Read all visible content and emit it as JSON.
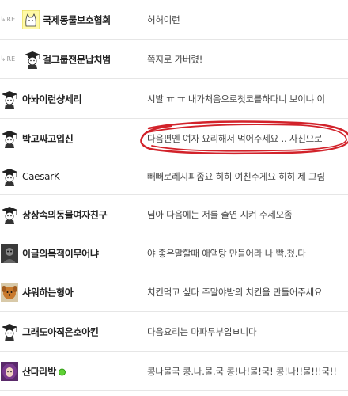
{
  "colors": {
    "highlight": "#d2222a",
    "online": "#5fd135"
  },
  "rows": [
    {
      "reply": true,
      "avatar_icon": "cat-avatar-icon",
      "nickname": "국제동물보호협회",
      "comment": "허허이런"
    },
    {
      "reply": true,
      "avatar_icon": "graduate-icon",
      "nickname": "걸그룹전문납치범",
      "comment": "쪽지로 가버렸!"
    },
    {
      "reply": false,
      "avatar_icon": "graduate-icon",
      "nickname": "아놔이런샹세리",
      "comment": "시발 ㅠ ㅠ 내가처음으로첫코를하다니 보이냐 이"
    },
    {
      "reply": false,
      "avatar_icon": "graduate-icon",
      "nickname": "박고싸고입신",
      "comment": "다음편엔 여자 요리해서 먹어주세요 .. 사진으로"
    },
    {
      "reply": false,
      "avatar_icon": "graduate-icon",
      "nickname": "CaesarK",
      "comment": "빼빼로레시피좀요 히히 여친주게요 히히 제 그림"
    },
    {
      "reply": false,
      "avatar_icon": "graduate-icon",
      "nickname": "상상속의동물여자친구",
      "comment": "님아 다음에는 저를 출연 시켜 주세오좀"
    },
    {
      "reply": false,
      "avatar_icon": "dark-photo-avatar-icon",
      "nickname": "이글의목적이무어냐",
      "comment": "야 좋은말할때 애액탕 만들어라 나 빡.쳤.다"
    },
    {
      "reply": false,
      "avatar_icon": "dog-avatar-icon",
      "nickname": "샤워하는형아",
      "comment": "치킨먹고 싶다 주말야밤의 치킨을 만들어주세요"
    },
    {
      "reply": false,
      "avatar_icon": "graduate-icon",
      "nickname": "그래도아직은호아킨",
      "comment": "다음요리는 마파두부입ㅂ니다"
    },
    {
      "reply": false,
      "avatar_icon": "girl-avatar-icon",
      "nickname": "산다라박",
      "comment": "콩나물국 콩.나.물.국 콩!나!물!국! 콩!나!!물!!!국!!",
      "online": true
    }
  ]
}
